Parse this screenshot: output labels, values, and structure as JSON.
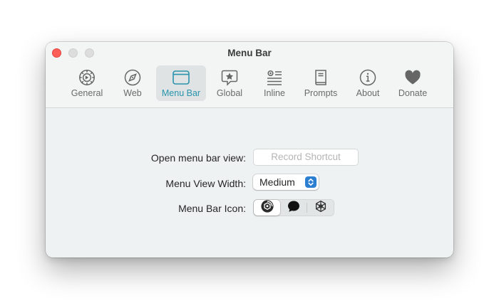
{
  "window": {
    "title": "Menu Bar"
  },
  "toolbar": {
    "tabs": [
      {
        "label": "General",
        "icon": "gear-icon"
      },
      {
        "label": "Web",
        "icon": "compass-icon"
      },
      {
        "label": "Menu Bar",
        "icon": "menu-bar-window-icon",
        "selected": true
      },
      {
        "label": "Global",
        "icon": "star-bubble-icon"
      },
      {
        "label": "Inline",
        "icon": "text-list-icon"
      },
      {
        "label": "Prompts",
        "icon": "book-icon"
      },
      {
        "label": "About",
        "icon": "info-icon"
      },
      {
        "label": "Donate",
        "icon": "heart-icon"
      }
    ]
  },
  "settings": {
    "shortcut_label": "Open menu bar view:",
    "shortcut_placeholder": "Record Shortcut",
    "width_label": "Menu View Width:",
    "width_value": "Medium",
    "icon_label": "Menu Bar Icon:",
    "icon_options": [
      "color-chat-logo-icon",
      "speech-bubble-icon",
      "openai-knot-icon"
    ],
    "icon_selected_index": 0
  },
  "colors": {
    "accent": "#2a93ad",
    "stepper_blue": "#2c7fd0",
    "close_red": "#ff5f57"
  }
}
